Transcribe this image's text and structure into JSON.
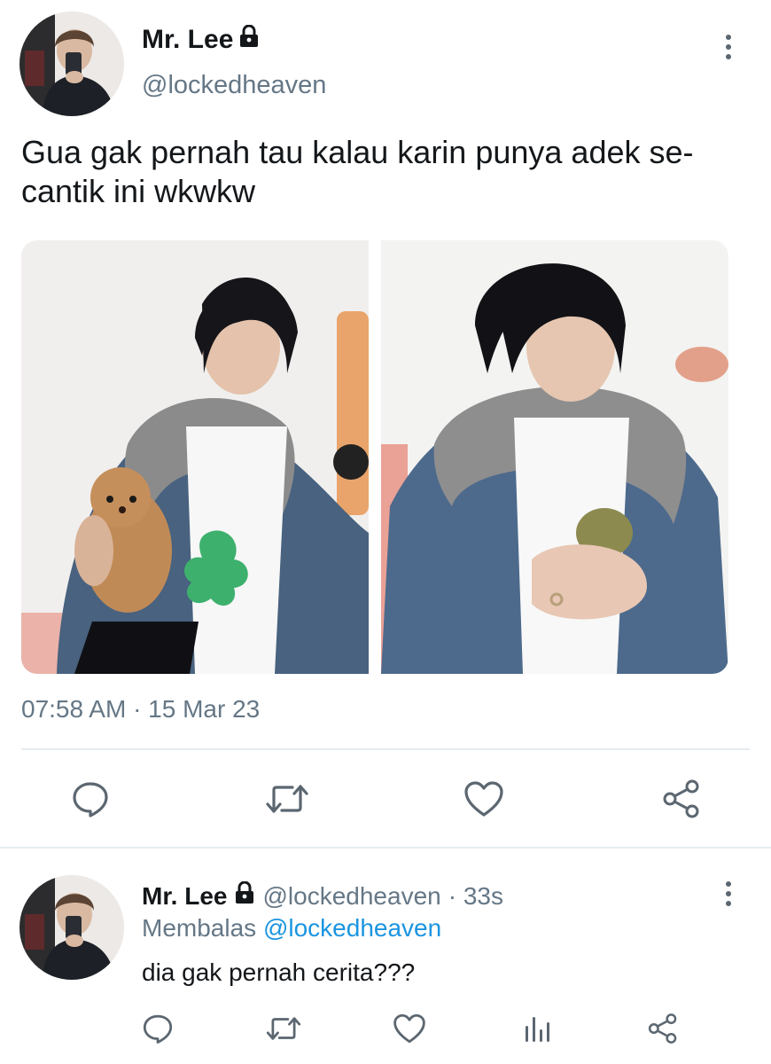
{
  "tweet": {
    "author_name": "Mr. Lee",
    "author_handle": "@lockedheaven",
    "lock_icon": "lock-icon",
    "text": "Gua gak pernah tau kalau karin punya adek se-cantik ini wkwkw",
    "media": [
      {
        "description_icon": "photo-man-holding-toy-dog"
      },
      {
        "description_icon": "photo-man-holding-plush"
      }
    ],
    "timestamp": "07:58 AM · 15 Mar 23",
    "actions": [
      "reply-icon",
      "retweet-icon",
      "like-icon",
      "share-icon"
    ]
  },
  "reply": {
    "author_name": "Mr. Lee",
    "author_handle": "@lockedheaven",
    "time": "· 33s",
    "replying_prefix": "Membalas",
    "replying_to": "@lockedheaven",
    "text": "dia gak pernah cerita???",
    "actions": [
      "reply-icon",
      "retweet-icon",
      "like-icon",
      "analytics-icon",
      "share-icon"
    ]
  },
  "colors": {
    "text_primary": "#14171a",
    "text_secondary": "#657786",
    "link": "#1b95e0",
    "icon": "#5b6670",
    "divider": "#e6ecf0"
  }
}
